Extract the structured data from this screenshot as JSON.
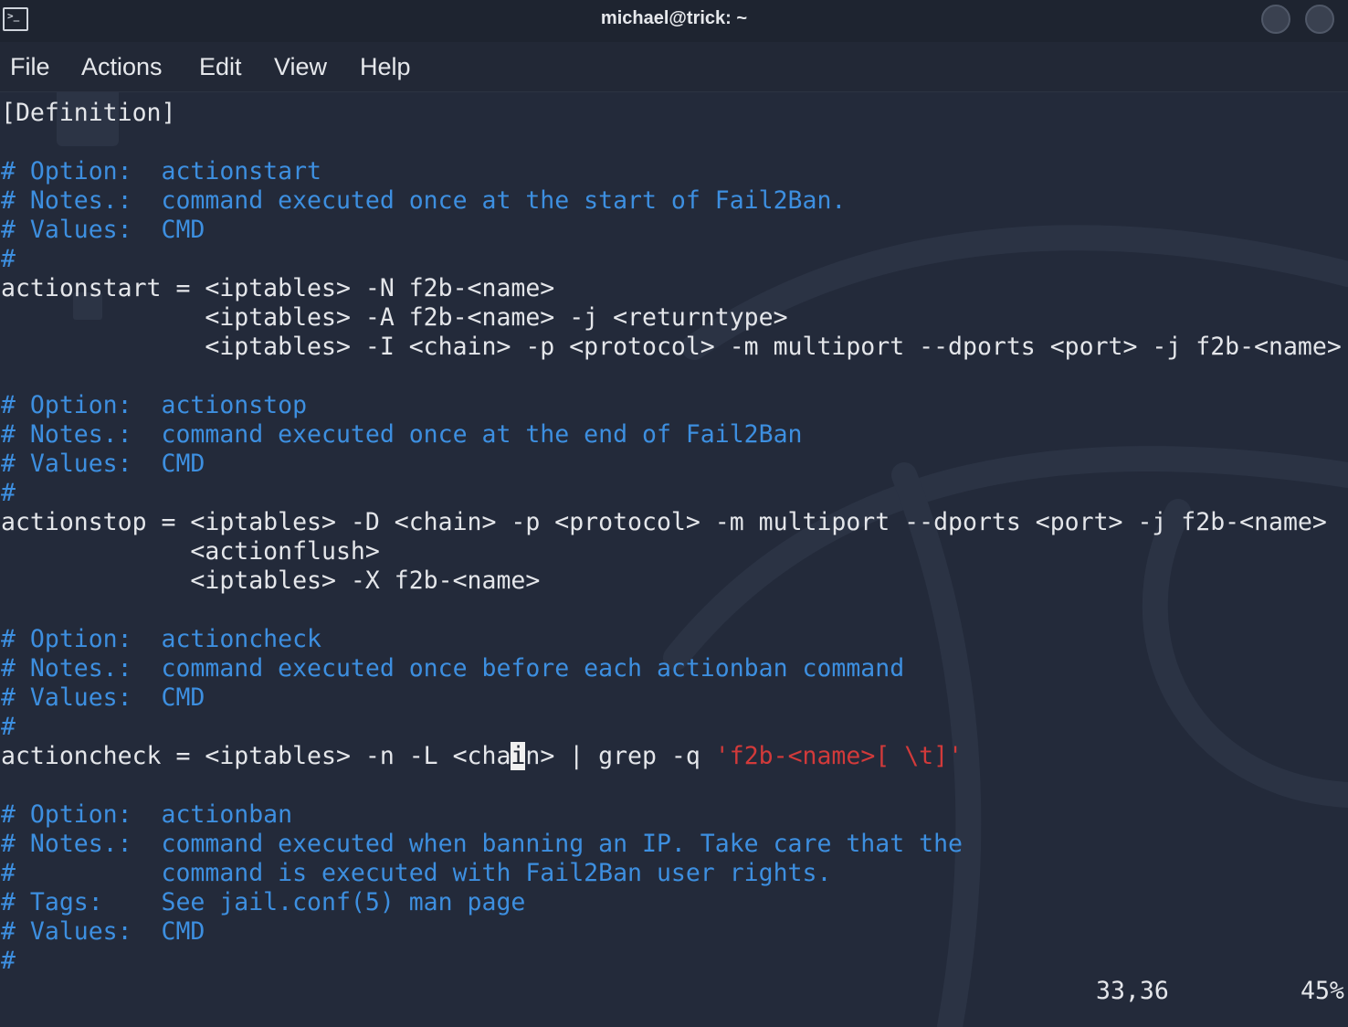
{
  "window": {
    "title": "michael@trick: ~",
    "terminal_icon": "terminal-icon",
    "buttons": [
      "minimize-button",
      "close-button"
    ]
  },
  "menu": {
    "items": [
      "File",
      "Actions",
      "Edit",
      "View",
      "Help"
    ]
  },
  "terminal": {
    "lines": [
      "[Definition]",
      "",
      "# Option:  actionstart",
      "# Notes.:  command executed once at the start of Fail2Ban.",
      "# Values:  CMD",
      "#",
      "actionstart = <iptables> -N f2b-<name>",
      "              <iptables> -A f2b-<name> -j <returntype>",
      "              <iptables> -I <chain> -p <protocol> -m multiport --dports <port> -j f2b-<name>",
      "",
      "# Option:  actionstop",
      "# Notes.:  command executed once at the end of Fail2Ban",
      "# Values:  CMD",
      "#",
      "actionstop = <iptables> -D <chain> -p <protocol> -m multiport --dports <port> -j f2b-<name>",
      "             <actionflush>",
      "             <iptables> -X f2b-<name>",
      "",
      "# Option:  actioncheck",
      "# Notes.:  command executed once before each actionban command",
      "# Values:  CMD",
      "#",
      "",
      "",
      "# Option:  actionban",
      "# Notes.:  command executed when banning an IP. Take care that the",
      "#          command is executed with Fail2Ban user rights.",
      "# Tags:    See jail.conf(5) man page",
      "# Values:  CMD",
      "#"
    ],
    "cursor_line": {
      "before": "actioncheck = <iptables> -n -L <cha",
      "cursor_char": "i",
      "after": "n> | grep -q ",
      "string": "'f2b-<name>[ \\t]'"
    },
    "colors": {
      "background": "#232a3a",
      "text": "#e4e6ea",
      "comment": "#3d8fe0",
      "string": "#d23a3a"
    }
  },
  "status": {
    "position": "33,36",
    "percent": "45%"
  }
}
